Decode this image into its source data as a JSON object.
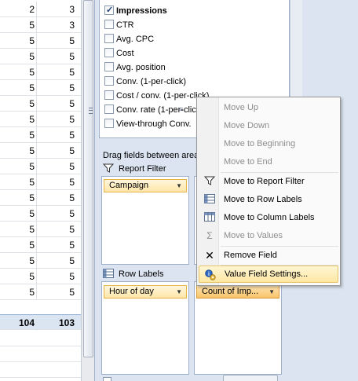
{
  "sheet": {
    "rows": [
      {
        "a": "2",
        "b": "3"
      },
      {
        "a": "5",
        "b": "3"
      },
      {
        "a": "5",
        "b": "5"
      },
      {
        "a": "5",
        "b": "5"
      },
      {
        "a": "5",
        "b": "5"
      },
      {
        "a": "5",
        "b": "5"
      },
      {
        "a": "5",
        "b": "5"
      },
      {
        "a": "5",
        "b": "5"
      },
      {
        "a": "5",
        "b": "5"
      },
      {
        "a": "5",
        "b": "5"
      },
      {
        "a": "5",
        "b": "5"
      },
      {
        "a": "5",
        "b": "5"
      },
      {
        "a": "5",
        "b": "5"
      },
      {
        "a": "5",
        "b": "5"
      },
      {
        "a": "5",
        "b": "5"
      },
      {
        "a": "5",
        "b": "5"
      },
      {
        "a": "5",
        "b": "5"
      },
      {
        "a": "5",
        "b": "5"
      },
      {
        "a": "5",
        "b": "5"
      }
    ],
    "total": {
      "a": "104",
      "b": "103"
    }
  },
  "fields": [
    {
      "label": "Impressions",
      "checked": true,
      "bold": true
    },
    {
      "label": "CTR",
      "checked": false
    },
    {
      "label": "Avg. CPC",
      "checked": false
    },
    {
      "label": "Cost",
      "checked": false
    },
    {
      "label": "Avg. position",
      "checked": false
    },
    {
      "label": "Conv. (1-per-click)",
      "checked": false
    },
    {
      "label": "Cost / conv. (1-per-click)",
      "checked": false
    },
    {
      "label": "Conv. rate (1-per-click)",
      "checked": false
    },
    {
      "label": "View-through Conv.",
      "checked": false
    }
  ],
  "panel": {
    "drag_label": "Drag fields between areas below:",
    "report_filter": "Report Filter",
    "row_labels": "Row Labels",
    "filter_chip": "Campaign",
    "row_chip": "Hour of day",
    "value_chip": "Count of Imp..."
  },
  "menu": {
    "move_up": "Move Up",
    "move_down": "Move Down",
    "move_beginning": "Move to Beginning",
    "move_end": "Move to End",
    "move_report_filter": "Move to Report Filter",
    "move_row_labels": "Move to Row Labels",
    "move_column_labels": "Move to Column Labels",
    "move_values": "Move to Values",
    "remove_field": "Remove Field",
    "value_field_settings": "Value Field Settings..."
  },
  "colors": {
    "accent": "#fde7a4",
    "panel_bg": "#dbe4f0",
    "total_bg": "#dbe5f1"
  }
}
